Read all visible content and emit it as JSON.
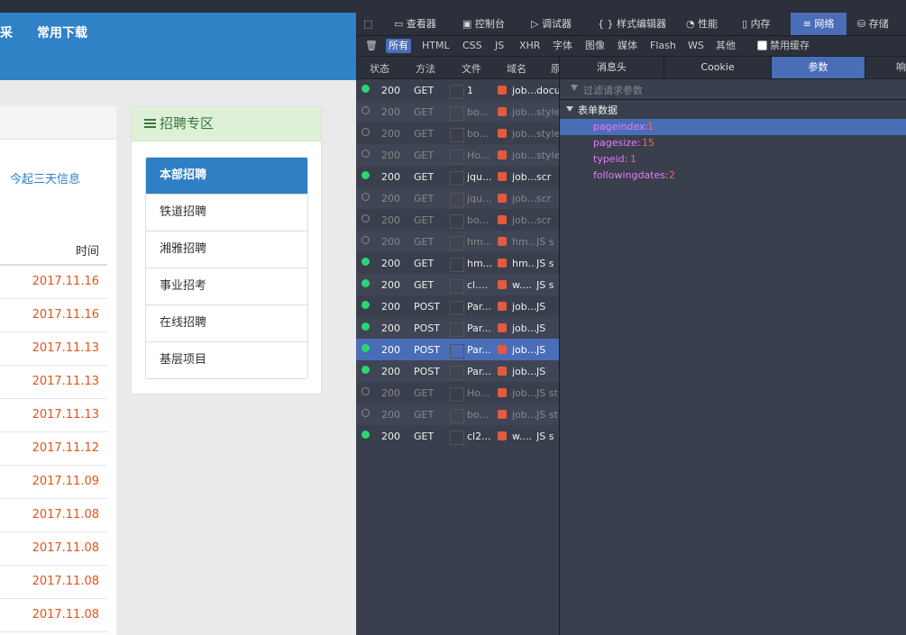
{
  "webpage": {
    "nav": [
      "采",
      "常用下载"
    ],
    "left_link": "今起三天信息",
    "time_header": "时间",
    "dates": [
      "2017.11.16",
      "2017.11.16",
      "2017.11.13",
      "2017.11.13",
      "2017.11.13",
      "2017.11.12",
      "2017.11.09",
      "2017.11.08",
      "2017.11.08",
      "2017.11.08",
      "2017.11.08"
    ],
    "recruit_panel": {
      "title": "招聘专区",
      "items": [
        "本部招聘",
        "铁道招聘",
        "湘雅招聘",
        "事业招考",
        "在线招聘",
        "基层项目"
      ]
    }
  },
  "devtools": {
    "tools": [
      "查看器",
      "控制台",
      "调试器",
      "样式编辑器",
      "性能",
      "内存",
      "网络",
      "存储"
    ],
    "filters": [
      "所有",
      "HTML",
      "CSS",
      "JS",
      "XHR",
      "字体",
      "图像",
      "媒体",
      "Flash",
      "WS",
      "其他"
    ],
    "disable_cache": "禁用缓存",
    "columns": [
      "状态",
      "方法",
      "文件",
      "域名",
      "原"
    ],
    "requests": [
      {
        "status": "200",
        "method": "GET",
        "file": "1",
        "domain": "job...",
        "type": "docu",
        "state": "ok"
      },
      {
        "status": "200",
        "method": "GET",
        "file": "bo...",
        "domain": "job...",
        "type": "style",
        "state": "cached"
      },
      {
        "status": "200",
        "method": "GET",
        "file": "bo...",
        "domain": "job...",
        "type": "style",
        "state": "cached"
      },
      {
        "status": "200",
        "method": "GET",
        "file": "Ho...",
        "domain": "job...",
        "type": "style",
        "state": "cached"
      },
      {
        "status": "200",
        "method": "GET",
        "file": "jqu...",
        "domain": "job...",
        "type": "scr",
        "state": "ok"
      },
      {
        "status": "200",
        "method": "GET",
        "file": "jqu...",
        "domain": "job...",
        "type": "scr",
        "state": "cached"
      },
      {
        "status": "200",
        "method": "GET",
        "file": "bo...",
        "domain": "job...",
        "type": "scr",
        "state": "cached"
      },
      {
        "status": "200",
        "method": "GET",
        "file": "hm...",
        "domain": "hm...",
        "type": "JS s",
        "state": "cached"
      },
      {
        "status": "200",
        "method": "GET",
        "file": "hm...",
        "domain": "hm...",
        "type": "JS s",
        "state": "ok"
      },
      {
        "status": "200",
        "method": "GET",
        "file": "cl....",
        "domain": "w....",
        "type": "JS s",
        "state": "ok"
      },
      {
        "status": "200",
        "method": "POST",
        "file": "Par...",
        "domain": "job...",
        "type": "JS",
        "state": "ok"
      },
      {
        "status": "200",
        "method": "POST",
        "file": "Par...",
        "domain": "job...",
        "type": "JS",
        "state": "ok"
      },
      {
        "status": "200",
        "method": "POST",
        "file": "Par...",
        "domain": "job...",
        "type": "JS",
        "state": "selected"
      },
      {
        "status": "200",
        "method": "POST",
        "file": "Par...",
        "domain": "job...",
        "type": "JS",
        "state": "ok"
      },
      {
        "status": "200",
        "method": "GET",
        "file": "Ho...",
        "domain": "job...",
        "type": "JS st",
        "state": "cached"
      },
      {
        "status": "200",
        "method": "GET",
        "file": "bo...",
        "domain": "job...",
        "type": "JS st",
        "state": "cached"
      },
      {
        "status": "200",
        "method": "GET",
        "file": "cl2...",
        "domain": "w....",
        "type": "JS s",
        "state": "ok"
      }
    ],
    "detail_tabs": [
      "消息头",
      "Cookie",
      "参数",
      "响"
    ],
    "filter_placeholder": "过滤请求参数",
    "form_section": "表单数据",
    "params": [
      {
        "key": "pageindex:",
        "value": "1"
      },
      {
        "key": "pagesize:",
        "value": "15"
      },
      {
        "key": "typeid:",
        "value": "1"
      },
      {
        "key": "followingdates:",
        "value": "2"
      }
    ]
  }
}
